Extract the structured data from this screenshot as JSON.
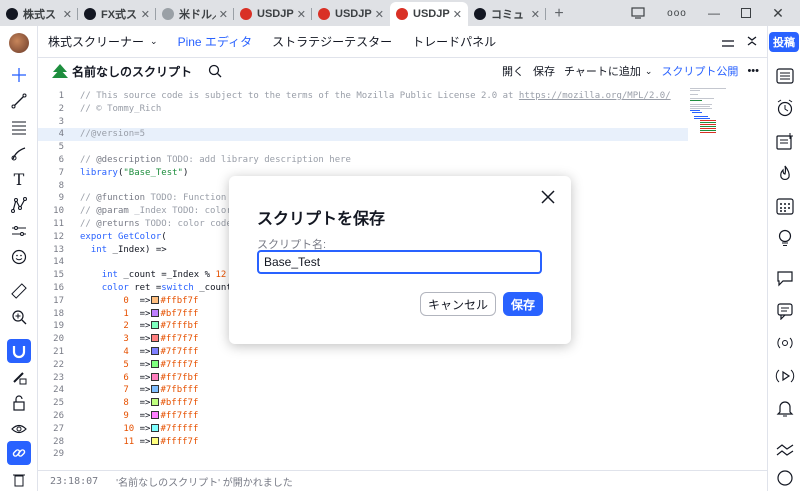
{
  "browser": {
    "tabs": [
      {
        "title": "株式ス",
        "favicon": "tradingview-icon",
        "color": "#131722"
      },
      {
        "title": "FX式ス",
        "favicon": "tradingview-icon",
        "color": "#131722"
      },
      {
        "title": "米ドル／円",
        "favicon": "yen-icon",
        "color": "#9aa0a6"
      },
      {
        "title": "USDJPY",
        "favicon": "us-flag-icon",
        "color": "#d93025"
      },
      {
        "title": "USDJPY",
        "favicon": "us-flag-icon",
        "color": "#d93025"
      },
      {
        "title": "USDJPY",
        "favicon": "us-flag-icon",
        "color": "#d93025"
      },
      {
        "title": "コミュ",
        "favicon": "community-icon",
        "color": "#131722"
      }
    ],
    "new_tab": "+",
    "more": "ooo"
  },
  "top_tabs": [
    {
      "label": "株式スクリーナー",
      "has_dropdown": true
    },
    {
      "label": "Pine エディタ",
      "active": true
    },
    {
      "label": "ストラテジーテスター"
    },
    {
      "label": "トレードパネル"
    }
  ],
  "editor": {
    "title": "名前なしのスクリプト",
    "actions": {
      "open": "開く",
      "save": "保存",
      "add_to_chart": "チャートに追加",
      "publish": "スクリプト公開",
      "more": "•••"
    }
  },
  "right_toolbar": {
    "post_label": "投稿"
  },
  "code": {
    "lines": [
      {
        "n": "1",
        "text": "// This source code is subject to the terms of the Mozilla Public License 2.0 at https://mozilla.org/MPL/2.0/"
      },
      {
        "n": "2",
        "text": "// © Tommy_Rich"
      },
      {
        "n": "3",
        "text": ""
      },
      {
        "n": "4",
        "text": "//@version=5"
      },
      {
        "n": "5",
        "text": ""
      },
      {
        "n": "6",
        "text": "// @description TODO: add library description here"
      },
      {
        "n": "7",
        "text": "library(\"Base_Test\")"
      },
      {
        "n": "8",
        "text": ""
      },
      {
        "n": "9",
        "text": "// @function TODO: Function t"
      },
      {
        "n": "10",
        "text": "// @param _Index TODO: color"
      },
      {
        "n": "11",
        "text": "// @returns TODO: color code"
      },
      {
        "n": "12",
        "text": "export GetColor("
      },
      {
        "n": "13",
        "text": "  int _Index) =>"
      },
      {
        "n": "14",
        "text": ""
      },
      {
        "n": "15",
        "text": "    int _count =_Index % 12"
      },
      {
        "n": "16",
        "text": "    color ret =switch _count"
      },
      {
        "n": "17",
        "text": "        0  =>",
        "hex": "#ffbf7f"
      },
      {
        "n": "18",
        "text": "        1  =>",
        "hex": "#bf7fff"
      },
      {
        "n": "19",
        "text": "        2  =>",
        "hex": "#7fffbf"
      },
      {
        "n": "20",
        "text": "        3  =>",
        "hex": "#ff7f7f"
      },
      {
        "n": "21",
        "text": "        4  =>",
        "hex": "#7f7fff"
      },
      {
        "n": "22",
        "text": "        5  =>",
        "hex": "#7fff7f"
      },
      {
        "n": "23",
        "text": "        6  =>",
        "hex": "#ff7fbf"
      },
      {
        "n": "24",
        "text": "        7  =>",
        "hex": "#7fbfff"
      },
      {
        "n": "25",
        "text": "        8  =>",
        "hex": "#bfff7f"
      },
      {
        "n": "26",
        "text": "        9  =>",
        "hex": "#ff7fff"
      },
      {
        "n": "27",
        "text": "        10 =>",
        "hex": "#7fffff"
      },
      {
        "n": "28",
        "text": "        11 =>",
        "hex": "#ffff7f"
      },
      {
        "n": "29",
        "text": ""
      }
    ]
  },
  "status": {
    "time": "23:18:07",
    "message": "'名前なしのスクリプト' が開かれました"
  },
  "dialog": {
    "title": "スクリプトを保存",
    "field_label": "スクリプト名:",
    "field_value": "Base_Test",
    "cancel": "キャンセル",
    "save": "保存"
  },
  "colors": {
    "accent": "#2962ff",
    "text": "#131722",
    "muted": "#787b86"
  }
}
